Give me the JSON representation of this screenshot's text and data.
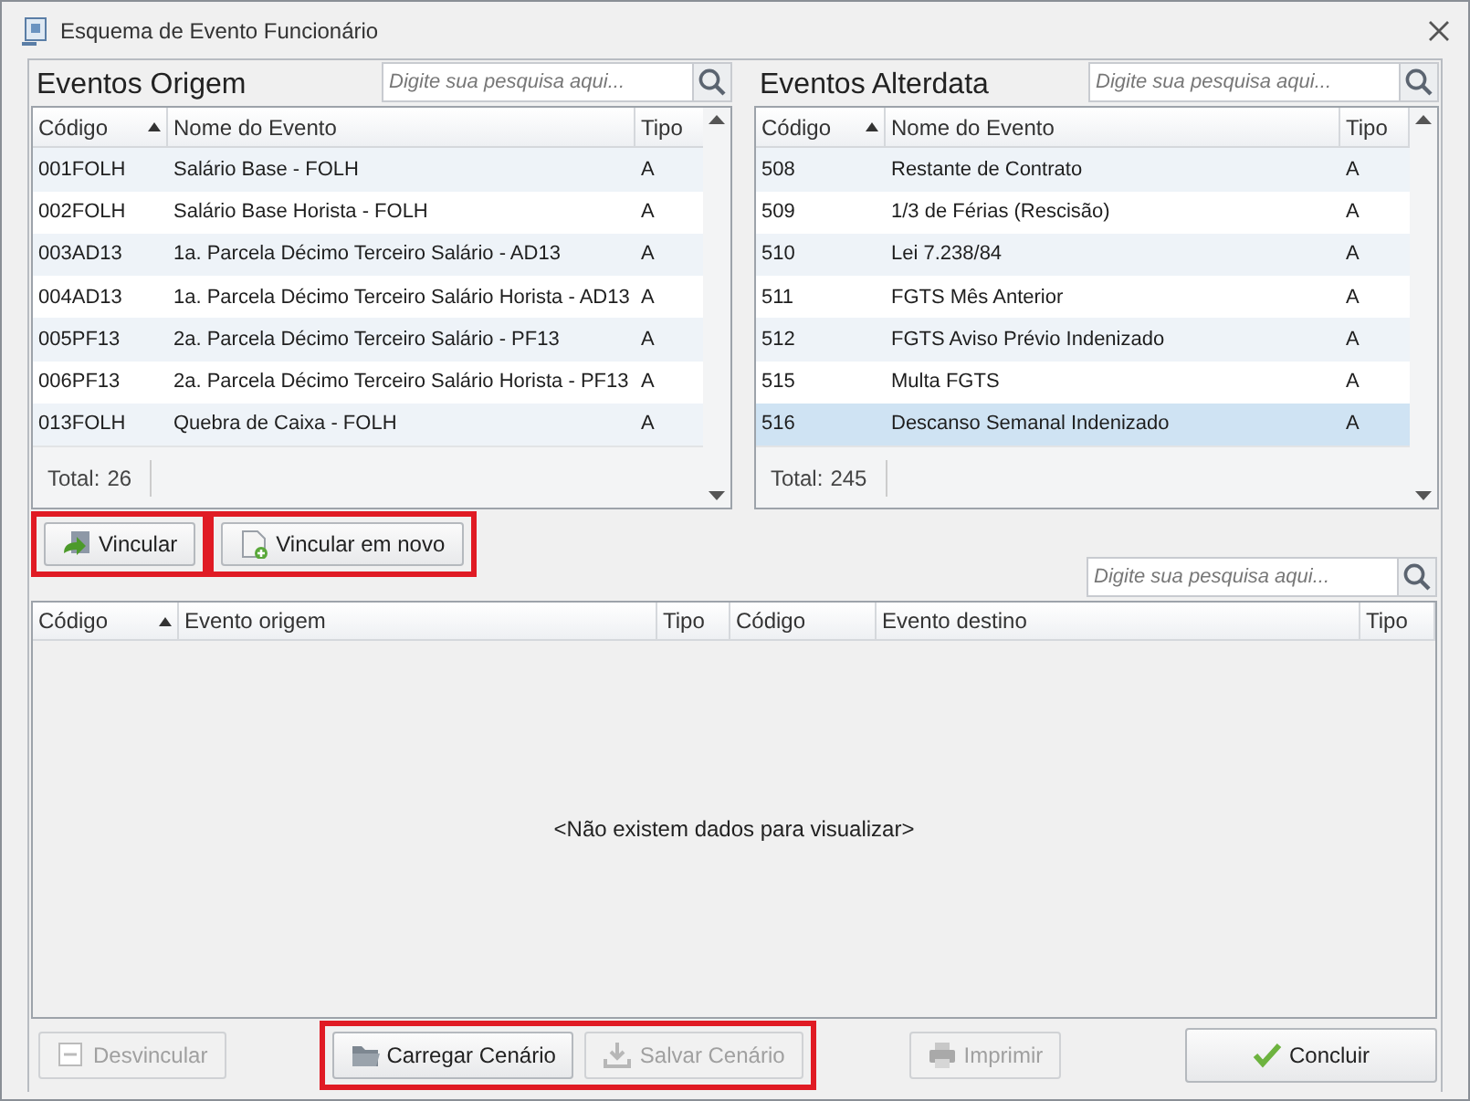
{
  "window": {
    "title": "Esquema de Evento Funcionário"
  },
  "source_panel": {
    "title": "Eventos Origem",
    "search": {
      "placeholder": "Digite sua pesquisa aqui..."
    },
    "columns": [
      "Código",
      "Nome do Evento",
      "Tipo"
    ],
    "rows": [
      {
        "cells": [
          "001FOLH",
          "Salário Base - FOLH",
          "A"
        ],
        "selected": false
      },
      {
        "cells": [
          "002FOLH",
          "Salário Base Horista - FOLH",
          "A"
        ],
        "selected": false
      },
      {
        "cells": [
          "003AD13",
          "1a. Parcela Décimo Terceiro Salário - AD13",
          "A"
        ],
        "selected": false
      },
      {
        "cells": [
          "004AD13",
          "1a. Parcela Décimo Terceiro Salário Horista - AD13",
          "A"
        ],
        "selected": false
      },
      {
        "cells": [
          "005PF13",
          "2a. Parcela Décimo Terceiro Salário - PF13",
          "A"
        ],
        "selected": false
      },
      {
        "cells": [
          "006PF13",
          "2a. Parcela Décimo Terceiro Salário Horista - PF13",
          "A"
        ],
        "selected": false
      },
      {
        "cells": [
          "013FOLH",
          "Quebra de Caixa - FOLH",
          "A"
        ],
        "selected": false
      }
    ],
    "total_label": "Total:",
    "total": "26"
  },
  "target_panel": {
    "title": "Eventos Alterdata",
    "search": {
      "placeholder": "Digite sua pesquisa aqui..."
    },
    "columns": [
      "Código",
      "Nome do Evento",
      "Tipo"
    ],
    "rows": [
      {
        "cells": [
          "508",
          "Restante de Contrato",
          "A"
        ],
        "selected": false
      },
      {
        "cells": [
          "509",
          "1/3 de Férias (Rescisão)",
          "A"
        ],
        "selected": false
      },
      {
        "cells": [
          "510",
          "Lei 7.238/84",
          "A"
        ],
        "selected": false
      },
      {
        "cells": [
          "511",
          "FGTS Mês Anterior",
          "A"
        ],
        "selected": false
      },
      {
        "cells": [
          "512",
          "FGTS Aviso Prévio Indenizado",
          "A"
        ],
        "selected": false
      },
      {
        "cells": [
          "515",
          "Multa FGTS",
          "A"
        ],
        "selected": false
      },
      {
        "cells": [
          "516",
          "Descanso Semanal Indenizado",
          "A"
        ],
        "selected": true
      }
    ],
    "total_label": "Total:",
    "total": "245"
  },
  "link_buttons": [
    {
      "label": "Vincular",
      "highlighted": true
    },
    {
      "label": "Vincular em novo",
      "highlighted": true
    }
  ],
  "mapping": {
    "search": {
      "placeholder": "Digite sua pesquisa aqui..."
    },
    "columns": [
      "Código",
      "Evento origem",
      "Tipo",
      "Código",
      "Evento destino",
      "Tipo"
    ],
    "empty_message": "<Não existem dados para visualizar>"
  },
  "footer_groups": [
    {
      "highlighted": false,
      "buttons": [
        {
          "label": "Desvincular",
          "disabled": true
        }
      ]
    },
    {
      "highlighted": true,
      "buttons": [
        {
          "label": "Carregar Cenário",
          "disabled": false
        },
        {
          "label": "Salvar Cenário",
          "disabled": true
        }
      ]
    },
    {
      "highlighted": false,
      "buttons": [
        {
          "label": "Imprimir",
          "disabled": true
        }
      ]
    }
  ],
  "confirm_button": {
    "label": "Concluir",
    "disabled": false
  }
}
